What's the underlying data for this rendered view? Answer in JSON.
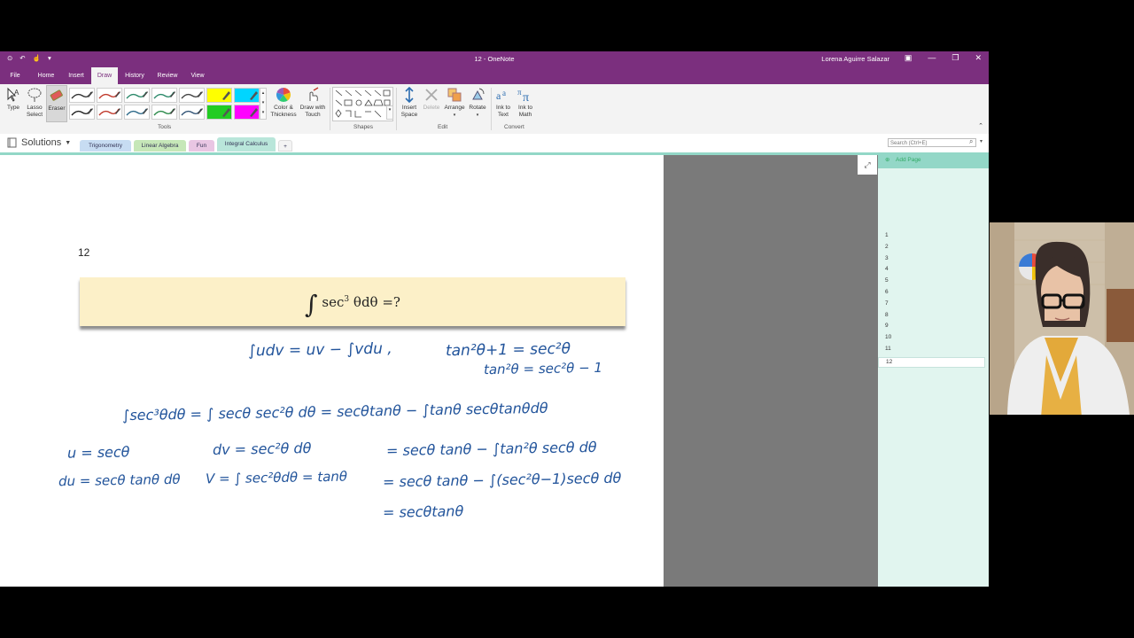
{
  "window": {
    "title": "12 - OneNote",
    "user": "Lorena Aguirre Salazar"
  },
  "menu": {
    "tabs": [
      "File",
      "Home",
      "Insert",
      "Draw",
      "History",
      "Review",
      "View"
    ],
    "active": "Draw"
  },
  "ribbon": {
    "type_label": "Type",
    "lasso_label": "Lasso Select",
    "eraser_label": "Eraser",
    "color_thickness_label": "Color & Thickness",
    "draw_touch_label": "Draw with Touch",
    "insert_space_label": "Insert Space",
    "delete_label": "Delete",
    "arrange_label": "Arrange",
    "rotate_label": "Rotate",
    "ink_text_label": "Ink to Text",
    "ink_math_label": "Ink to Math",
    "groups": {
      "tools": "Tools",
      "shapes": "Shapes",
      "edit": "Edit",
      "convert": "Convert"
    },
    "pen_colors": [
      "#333333",
      "#c0392b",
      "#2d8a6b",
      "#2d8a6b",
      "#444444",
      "#ffff00",
      "#00d5ff",
      "#222222",
      "#c0392b",
      "#2d6a8a",
      "#2d8a4b",
      "#335577",
      "#22cc22",
      "#ff00ff"
    ]
  },
  "nav": {
    "notebook": "Solutions",
    "sections": [
      {
        "label": "Trigonometry",
        "color": "#c7dcf2"
      },
      {
        "label": "Linear Algebra",
        "color": "#c6e7b8"
      },
      {
        "label": "Fun",
        "color": "#e9c6e3"
      },
      {
        "label": "Integral Calculus",
        "color": "#b9e6da"
      }
    ],
    "add_section": "+",
    "search_placeholder": "Search (Ctrl+E)"
  },
  "pages_panel": {
    "add_page": "Add Page",
    "pages": [
      "1",
      "2",
      "3",
      "4",
      "5",
      "6",
      "7",
      "8",
      "9",
      "10",
      "11",
      "12"
    ],
    "selected": "12"
  },
  "page": {
    "title": "12",
    "formula": {
      "prefix": "∫",
      "sec": "sec",
      "exp": "3",
      "rest": " θdθ =?"
    },
    "ink": {
      "l1": "∫udv = uv − ∫vdu ,",
      "l2": "tan²θ+1 = sec²θ",
      "l3": "tan²θ = sec²θ − 1",
      "l4": "∫sec³θdθ = ∫ secθ sec²θ dθ = secθtanθ − ∫tanθ secθtanθdθ",
      "l5": "u = secθ",
      "l6": "dv = sec²θ dθ",
      "l7": "= secθ tanθ − ∫tan²θ secθ dθ",
      "l8": "du = secθ tanθ dθ",
      "l9": "V = ∫ sec²θdθ = tanθ",
      "l10": "= secθ tanθ − ∫(sec²θ−1)secθ dθ",
      "l11": "= secθtanθ"
    }
  }
}
